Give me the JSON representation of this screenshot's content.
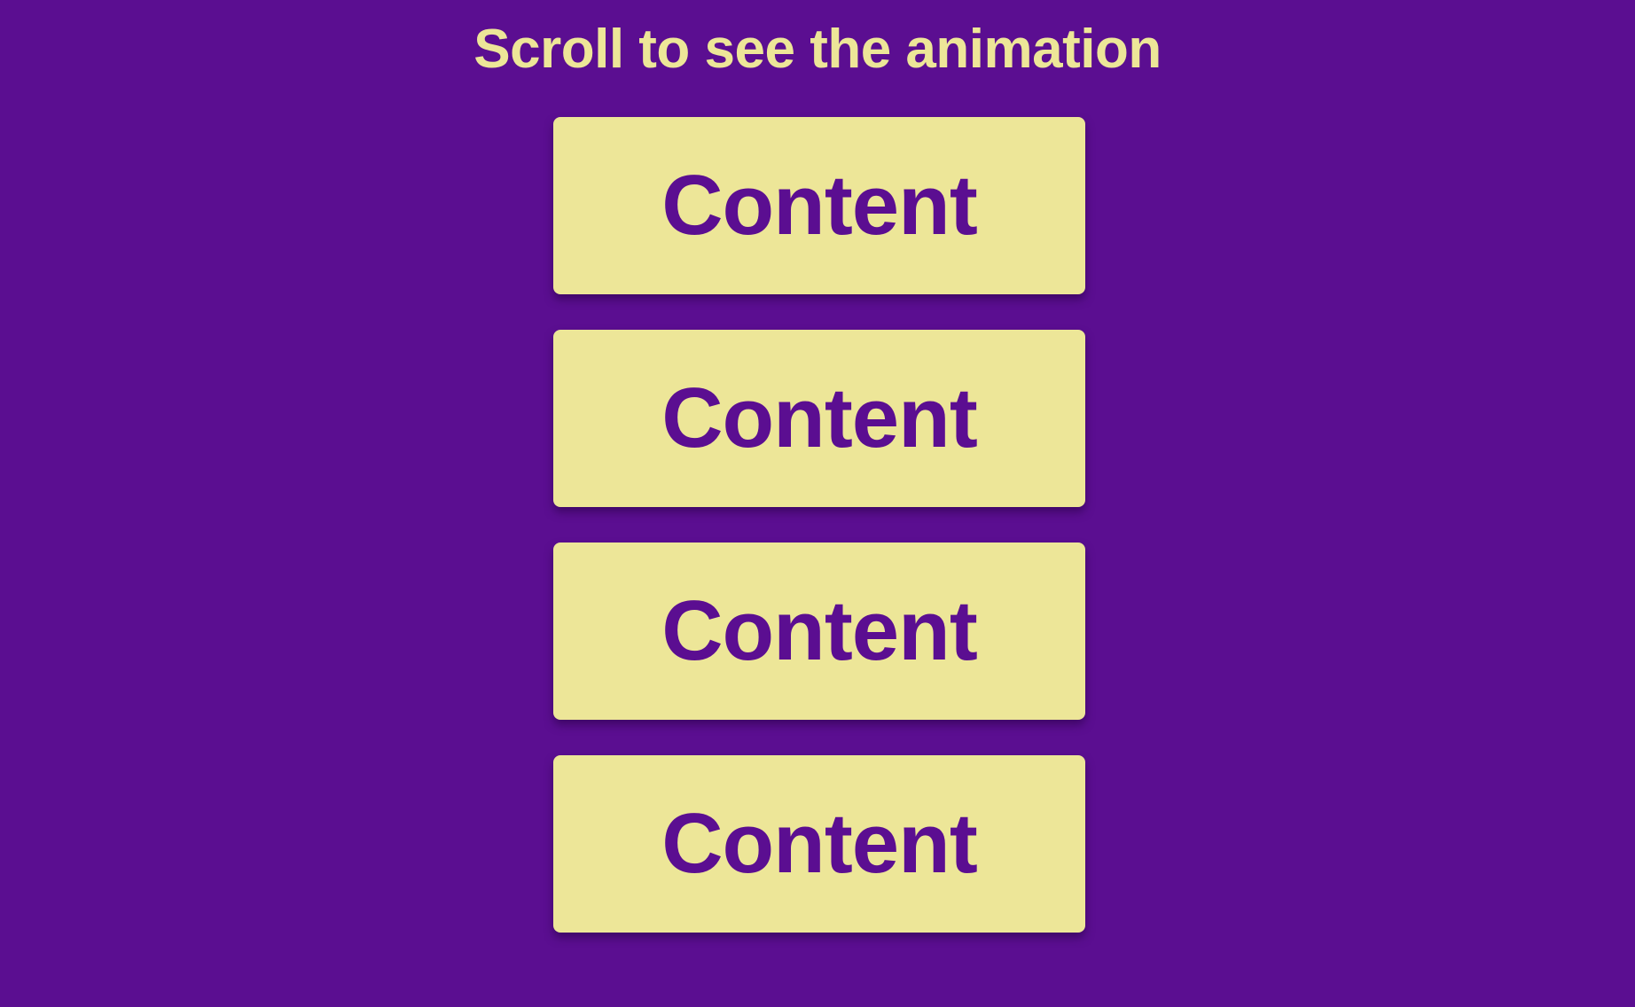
{
  "page": {
    "title": "Scroll to see the animation",
    "background_color": "#5b0e91",
    "card_color": "#ede698",
    "text_color": "#ede698",
    "card_text_color": "#5b0e91"
  },
  "cards": [
    {
      "label": "Content"
    },
    {
      "label": "Content"
    },
    {
      "label": "Content"
    },
    {
      "label": "Content"
    }
  ]
}
